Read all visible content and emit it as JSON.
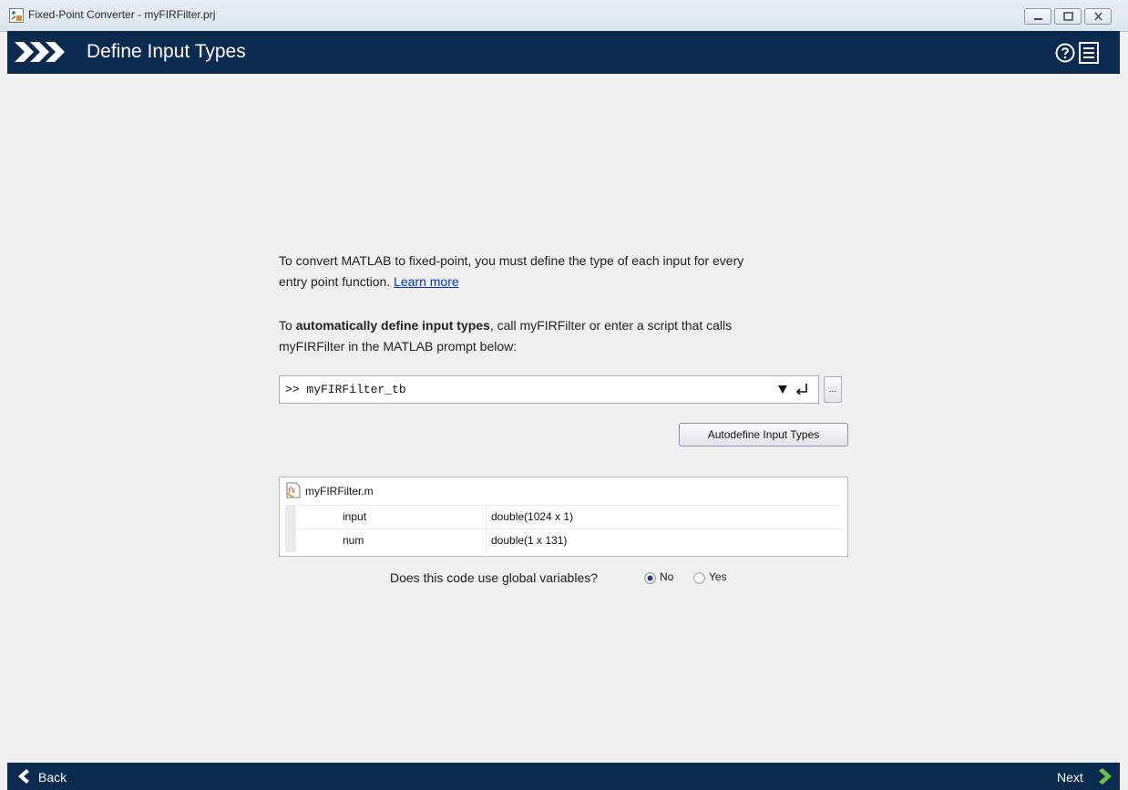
{
  "window": {
    "title": "Fixed-Point Converter - myFIRFilter.prj"
  },
  "header": {
    "title": "Define Input Types",
    "bg_color": "#0b2a50"
  },
  "intro": {
    "line1": "To convert MATLAB to fixed-point, you must define the type of each input for every",
    "line2_text": "entry point function. ",
    "learn_more": "Learn more"
  },
  "auto": {
    "prefix": "To ",
    "bold": "automatically define input types",
    "suffix": ", call myFIRFilter or enter a script that calls",
    "line2": "myFIRFilter in the MATLAB prompt below:"
  },
  "prompt": {
    "value": ">> myFIRFilter_tb",
    "browse_label": "..."
  },
  "autodefine_button": "Autodefine Input Types",
  "function": {
    "file_name": "myFIRFilter.m",
    "inputs": [
      {
        "name": "input",
        "type": "double(1024 x 1)"
      },
      {
        "name": "num",
        "type": "double(1 x 131)"
      }
    ]
  },
  "globals": {
    "question": "Does this code use global variables?",
    "options": [
      "No",
      "Yes"
    ],
    "selected": "No"
  },
  "footer": {
    "back_label": "Back",
    "next_label": "Next",
    "accent_color": "#6cc04a"
  }
}
